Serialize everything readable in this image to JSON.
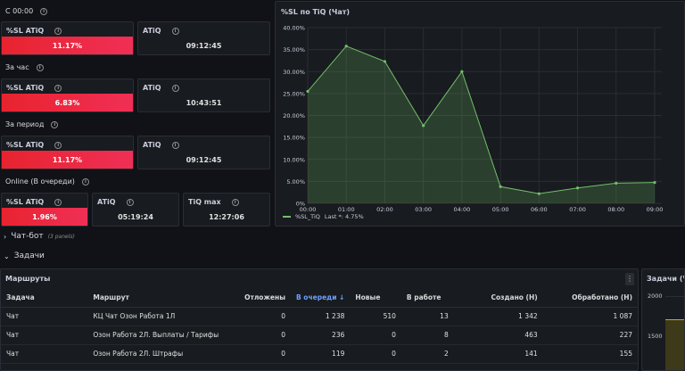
{
  "sections": {
    "since_midnight": "С 00:00",
    "last_hour": "За час",
    "period": "За период",
    "online": "Online (В очереди)"
  },
  "stats": {
    "s1": {
      "label": "%SL ATiQ",
      "value": "11.17%"
    },
    "s2": {
      "label": "ATiQ",
      "value": "09:12:45"
    },
    "s3": {
      "label": "%SL ATiQ",
      "value": "6.83%"
    },
    "s4": {
      "label": "ATiQ",
      "value": "10:43:51"
    },
    "s5": {
      "label": "%SL ATiQ",
      "value": "11.17%"
    },
    "s6": {
      "label": "ATiQ",
      "value": "09:12:45"
    },
    "s7": {
      "label": "%SL ATiQ",
      "value": "1.96%"
    },
    "s8": {
      "label": "ATiQ",
      "value": "05:19:24"
    },
    "s9": {
      "label": "TiQ max",
      "value": "12:27:06"
    }
  },
  "chart_title": "%SL по TiQ (Чат)",
  "chart_data": {
    "type": "area",
    "x": [
      "00:00",
      "01:00",
      "02:00",
      "03:00",
      "04:00",
      "05:00",
      "06:00",
      "07:00",
      "08:00",
      "09:00"
    ],
    "series": [
      {
        "name": "%SL_TiQ",
        "values": [
          25.5,
          35.8,
          32.3,
          17.7,
          30.0,
          3.8,
          2.2,
          3.5,
          4.6,
          4.75
        ],
        "color": "#73bf69"
      }
    ],
    "y_ticks": [
      "0%",
      "5.00%",
      "10.00%",
      "15.00%",
      "20.00%",
      "25.00%",
      "30.00%",
      "35.00%",
      "40.00%"
    ],
    "ylim": [
      0,
      40
    ],
    "grid": true,
    "legend_position": "bottom-left"
  },
  "legend": {
    "series": "%SL_TiQ",
    "last": "Last *: 4.75%"
  },
  "rows": {
    "chatbot": {
      "title": "Чат-бот",
      "sub": "(3 panels)"
    },
    "tasks": {
      "title": "Задачи"
    }
  },
  "routes_panel": {
    "title": "Маршруты",
    "columns": [
      "Задача",
      "Маршрут",
      "Отложены",
      "В очереди ↓",
      "Новые",
      "В работе",
      "Создано (Н)",
      "Обработано (Н)"
    ],
    "rows": [
      [
        "Чат",
        "КЦ Чат Озон Работа 1Л",
        "0",
        "1 238",
        "510",
        "13",
        "1 342",
        "1 087"
      ],
      [
        "Чат",
        "Озон Работа 2Л. Выплаты / Тарифы",
        "0",
        "236",
        "0",
        "8",
        "463",
        "227"
      ],
      [
        "Чат",
        "Озон Работа 2Л. Штрафы",
        "0",
        "119",
        "0",
        "2",
        "141",
        "155"
      ]
    ]
  },
  "tasks_panel": {
    "title": "Задачи (Чат",
    "y_ticks": [
      "2000",
      "1500"
    ]
  },
  "colors": {
    "accent_green": "#73bf69",
    "stat_red": "#e8232f",
    "bg": "#111217",
    "panel": "#181b1f"
  }
}
